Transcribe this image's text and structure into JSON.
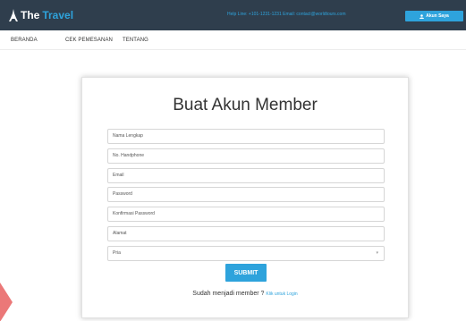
{
  "brand": {
    "icon": "eiffel-tower-icon",
    "name_part1": "The",
    "name_part2": "Travel"
  },
  "header": {
    "help_line": "Help Line: +101-1231-1231  Email: contact@worldtours.com",
    "account_button": {
      "label": "Akun Saya",
      "icon": "user-icon"
    }
  },
  "nav": [
    "BERANDA",
    "CEK PEMESANAN",
    "TENTANG"
  ],
  "form": {
    "title": "Buat Akun Member",
    "fields": [
      {
        "placeholder": "Nama Lengkap"
      },
      {
        "placeholder": "No. Handphone"
      },
      {
        "placeholder": "Email"
      },
      {
        "placeholder": "Password"
      },
      {
        "placeholder": "Konfirmasi Password"
      },
      {
        "placeholder": "Alamat"
      }
    ],
    "gender_select": {
      "value": "Pria"
    },
    "submit_label": "SUBMIT",
    "login_prompt": "Sudah menjadi member ?",
    "login_link": "Klik untuk Login"
  },
  "colors": {
    "header_bg": "#2f3e4d",
    "accent": "#2ea3dc"
  }
}
